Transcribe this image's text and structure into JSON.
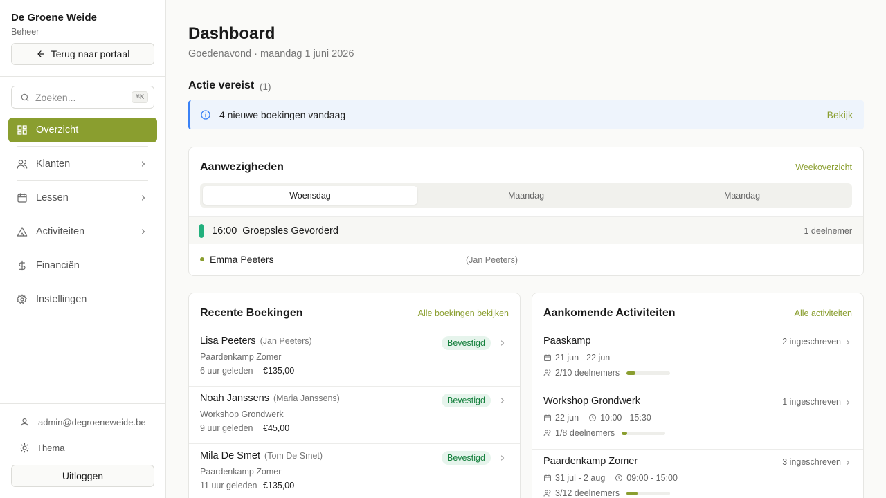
{
  "sidebar": {
    "brand": "De Groene Weide",
    "brand_sub": "Beheer",
    "back_label": "Terug naar portaal",
    "search_placeholder": "Zoeken...",
    "search_shortcut": "⌘K",
    "items": [
      {
        "label": "Overzicht",
        "icon": "grid-icon",
        "active": true
      },
      {
        "label": "Klanten",
        "icon": "users-icon",
        "has_children": true
      },
      {
        "label": "Lessen",
        "icon": "calendar-icon",
        "has_children": true
      },
      {
        "label": "Activiteiten",
        "icon": "tent-icon",
        "has_children": true
      },
      {
        "label": "Financiën",
        "icon": "dollar-icon"
      },
      {
        "label": "Instellingen",
        "icon": "gear-icon"
      }
    ],
    "user_email": "admin@degroeneweide.be",
    "theme_label": "Thema",
    "logout_label": "Uitloggen"
  },
  "header": {
    "title": "Dashboard",
    "subtitle": "Goedenavond · maandag 1 juni 2026"
  },
  "action_required": {
    "title": "Actie vereist",
    "count": "(1)",
    "alert_text": "4 nieuwe boekingen vandaag",
    "alert_link": "Bekijk"
  },
  "attendance": {
    "title": "Aanwezigheden",
    "link": "Weekoverzicht",
    "tabs": [
      "Woensdag",
      "Maandag",
      "Maandag"
    ],
    "session": {
      "time": "16:00",
      "name": "Groepsles Gevorderd",
      "count": "1 deelnemer"
    },
    "participant": {
      "name": "Emma Peeters",
      "parent": "(Jan Peeters)"
    }
  },
  "bookings": {
    "title": "Recente Boekingen",
    "link": "Alle boekingen bekijken",
    "rows": [
      {
        "name": "Lisa Peeters",
        "parent": "(Jan Peeters)",
        "activity": "Paardenkamp Zomer",
        "ago": "6 uur geleden",
        "price": "€135,00",
        "status": "Bevestigd"
      },
      {
        "name": "Noah Janssens",
        "parent": "(Maria Janssens)",
        "activity": "Workshop Grondwerk",
        "ago": "9 uur geleden",
        "price": "€45,00",
        "status": "Bevestigd"
      },
      {
        "name": "Mila De Smet",
        "parent": "(Tom De Smet)",
        "activity": "Paardenkamp Zomer",
        "ago": "11 uur geleden",
        "price": "€135,00",
        "status": "Bevestigd"
      }
    ]
  },
  "activities": {
    "title": "Aankomende Activiteiten",
    "link": "Alle activiteiten",
    "rows": [
      {
        "name": "Paaskamp",
        "count": "2 ingeschreven",
        "dates": "21 jun - 22 jun",
        "time": "",
        "participants": "2/10 deelnemers",
        "fill": 0.2
      },
      {
        "name": "Workshop Grondwerk",
        "count": "1 ingeschreven",
        "dates": "22 jun",
        "time": "10:00 - 15:30",
        "participants": "1/8 deelnemers",
        "fill": 0.125
      },
      {
        "name": "Paardenkamp Zomer",
        "count": "3 ingeschreven",
        "dates": "31 jul - 2 aug",
        "time": "09:00 - 15:00",
        "participants": "3/12 deelnemers",
        "fill": 0.25
      }
    ]
  },
  "colors": {
    "accent": "#8a9e2f",
    "info": "#3b82f6",
    "success": "#15803d",
    "session_bar": "#22b07d"
  }
}
